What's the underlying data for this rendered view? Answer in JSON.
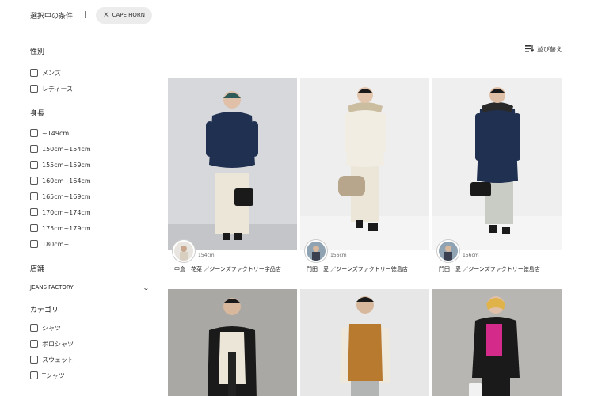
{
  "selected": {
    "label": "選択中の条件",
    "separator": "|",
    "chip": "CAPE HORN",
    "chip_close": "×"
  },
  "sort": {
    "label": "並び替え"
  },
  "filters": {
    "gender": {
      "title": "性別",
      "options": [
        "メンズ",
        "レディース"
      ]
    },
    "height": {
      "title": "身長",
      "options": [
        "~149cm",
        "150cm~154cm",
        "155cm~159cm",
        "160cm~164cm",
        "165cm~169cm",
        "170cm~174cm",
        "175cm~179cm",
        "180cm~"
      ]
    },
    "store": {
      "title": "店舗",
      "value": "JEANS FACTORY"
    },
    "category": {
      "title": "カテゴリ",
      "options": [
        "シャツ",
        "ポロシャツ",
        "スウェット",
        "Tシャツ"
      ]
    }
  },
  "cards": [
    {
      "height": "154cm",
      "staff": "中倉　花菜 ／ジーンズファクトリー宇品店"
    },
    {
      "height": "156cm",
      "staff": "門田　愛 ／ジーンズファクトリー徳島店"
    },
    {
      "height": "156cm",
      "staff": "門田　愛 ／ジーンズファクトリー徳島店"
    },
    {
      "height": "",
      "staff": ""
    },
    {
      "height": "",
      "staff": ""
    },
    {
      "height": "",
      "staff": ""
    }
  ],
  "colors": {
    "chip_bg": "#ececec",
    "navy_jacket": "#1f3050",
    "cream": "#ece6d8",
    "camel": "#b87a2f",
    "black": "#1a1a1a",
    "magenta": "#d42a8a"
  }
}
